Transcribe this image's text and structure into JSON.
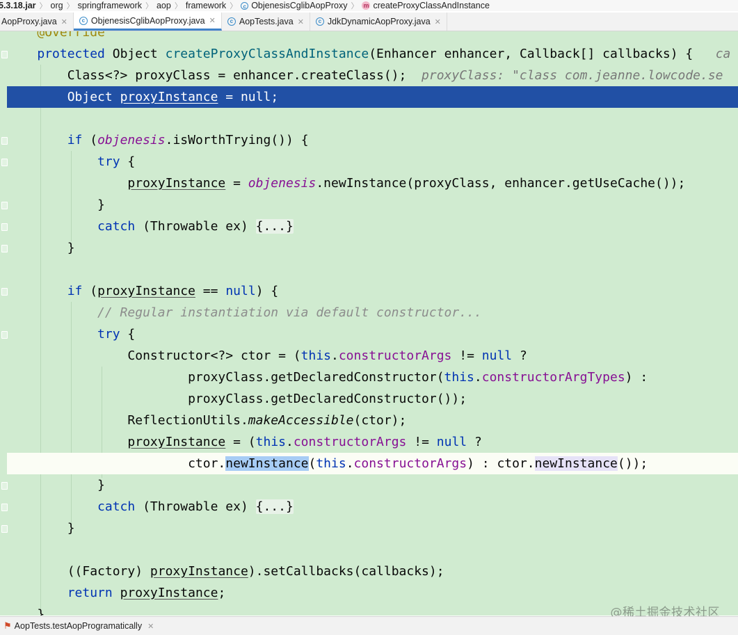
{
  "breadcrumb": {
    "jar": "5.3.18.jar",
    "items": [
      "org",
      "springframework",
      "aop",
      "framework"
    ],
    "class_name": "ObjenesisCglibAopProxy",
    "method_name": "createProxyClassAndInstance"
  },
  "tabs": [
    {
      "label": "AopProxy.java"
    },
    {
      "label": "ObjenesisCglibAopProxy.java"
    },
    {
      "label": "AopTests.java"
    },
    {
      "label": "JdkDynamicAopProxy.java"
    }
  ],
  "code": {
    "partial_annotation": "@Override",
    "hint_proxy_class": "proxyClass: \"class com.jeanne.lowcode.se",
    "hint_params_trunc": "ca",
    "comment_regular": "// Regular instantiation via default constructor...",
    "folded": "{...}"
  },
  "run_config": {
    "label": "AopTests.testAopProgramatically"
  },
  "watermark": "@稀土掘金技术社区",
  "colors": {
    "editor_bg": "#d0ebd0",
    "selection": "#2150a5",
    "keyword": "#0033b3",
    "field": "#871094",
    "comment": "#8c8c8c"
  }
}
